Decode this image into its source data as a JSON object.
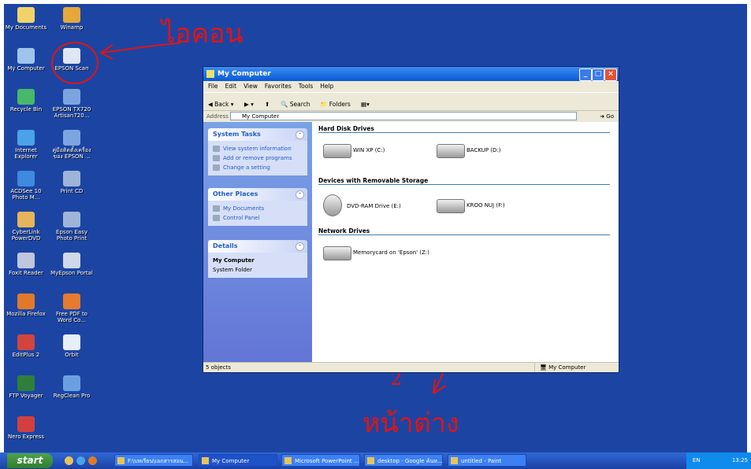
{
  "desktop": {
    "icons_col1": [
      {
        "label": "My Documents",
        "icon": "folder-icon",
        "color": "#f2d36b"
      },
      {
        "label": "My Computer",
        "icon": "computer-icon",
        "color": "#9ec4ee"
      },
      {
        "label": "Recycle Bin",
        "icon": "recycle-bin-icon",
        "color": "#48b86a"
      },
      {
        "label": "Internet Explorer",
        "icon": "ie-icon",
        "color": "#4aa3e8"
      },
      {
        "label": "ACDSee 10 Photo M...",
        "icon": "acdsee-icon",
        "color": "#3d8ae0"
      },
      {
        "label": "CyberLink PowerDVD",
        "icon": "powerdvd-icon",
        "color": "#e6b45a"
      },
      {
        "label": "Foxit Reader",
        "icon": "foxit-icon",
        "color": "#c0c6dd"
      },
      {
        "label": "Mozilla Firefox",
        "icon": "firefox-icon",
        "color": "#e07a2a"
      },
      {
        "label": "EditPlus 2",
        "icon": "editplus-icon",
        "color": "#d2453e"
      },
      {
        "label": "FTP Voyager",
        "icon": "ftp-icon",
        "color": "#2f7f3a"
      },
      {
        "label": "Nero Express",
        "icon": "nero-icon",
        "color": "#d04040"
      }
    ],
    "icons_col2": [
      {
        "label": "Winamp",
        "icon": "winamp-icon",
        "color": "#e5a83a"
      },
      {
        "label": "EPSON Scan",
        "icon": "epson-scan-icon",
        "color": "#dfe6f5"
      },
      {
        "label": "EPSON TX720 Artisan720...",
        "icon": "printer-icon",
        "color": "#7ca5e0"
      },
      {
        "label": "คู่มือติดตั้งเครื่อง ของ EPSON ...",
        "icon": "printer-manual-icon",
        "color": "#7ca5e0"
      },
      {
        "label": "Print CD",
        "icon": "print-cd-icon",
        "color": "#9fb4d8"
      },
      {
        "label": "Epson Easy Photo Print",
        "icon": "easy-photo-icon",
        "color": "#9fb4d8"
      },
      {
        "label": "MyEpson Portal",
        "icon": "myepson-icon",
        "color": "#cfd8ea"
      },
      {
        "label": "Free PDF to Word Co...",
        "icon": "pdf-word-icon",
        "color": "#e57a30"
      },
      {
        "label": "Orbit",
        "icon": "orbit-icon",
        "color": "#e8eef8"
      },
      {
        "label": "RegClean Pro",
        "icon": "regclean-icon",
        "color": "#6aa0e0"
      }
    ],
    "annotation_top": "ไอคอน",
    "annotation_bottom_number": "2",
    "annotation_bottom": "หน้าต่าง"
  },
  "window": {
    "title": "My Computer",
    "menu": [
      "File",
      "Edit",
      "View",
      "Favorites",
      "Tools",
      "Help"
    ],
    "toolbar": {
      "back": "Back",
      "search": "Search",
      "folders": "Folders"
    },
    "address_label": "Address",
    "address_value": "My Computer",
    "go_label": "Go",
    "panels": [
      {
        "title": "System Tasks",
        "items": [
          "View system information",
          "Add or remove programs",
          "Change a setting"
        ]
      },
      {
        "title": "Other Places",
        "items": [
          "My Documents",
          "Control Panel"
        ]
      },
      {
        "title": "Details",
        "name": "My Computer",
        "sub": "System Folder"
      }
    ],
    "sections": {
      "hdd": "Hard Disk Drives",
      "removable": "Devices with Removable Storage",
      "network": "Network Drives"
    },
    "drives": {
      "c": "WIN XP (C:)",
      "d": "BACKUP (D:)",
      "e": "DVD-RAM Drive (E:)",
      "f": "KROO NUJ (F:)",
      "z": "Memorycard on 'Epson' (Z:)"
    },
    "status_left": "5 objects",
    "status_right": "My Computer"
  },
  "taskbar": {
    "start": "start",
    "buttons": [
      "F:\\บทเรียน\\เอกสารสอน...",
      "My Computer",
      "Microsoft PowerPoint ...",
      "desktop - Google ค้นห...",
      "untitled - Paint"
    ],
    "tray": "EN",
    "clock": "13:25"
  }
}
